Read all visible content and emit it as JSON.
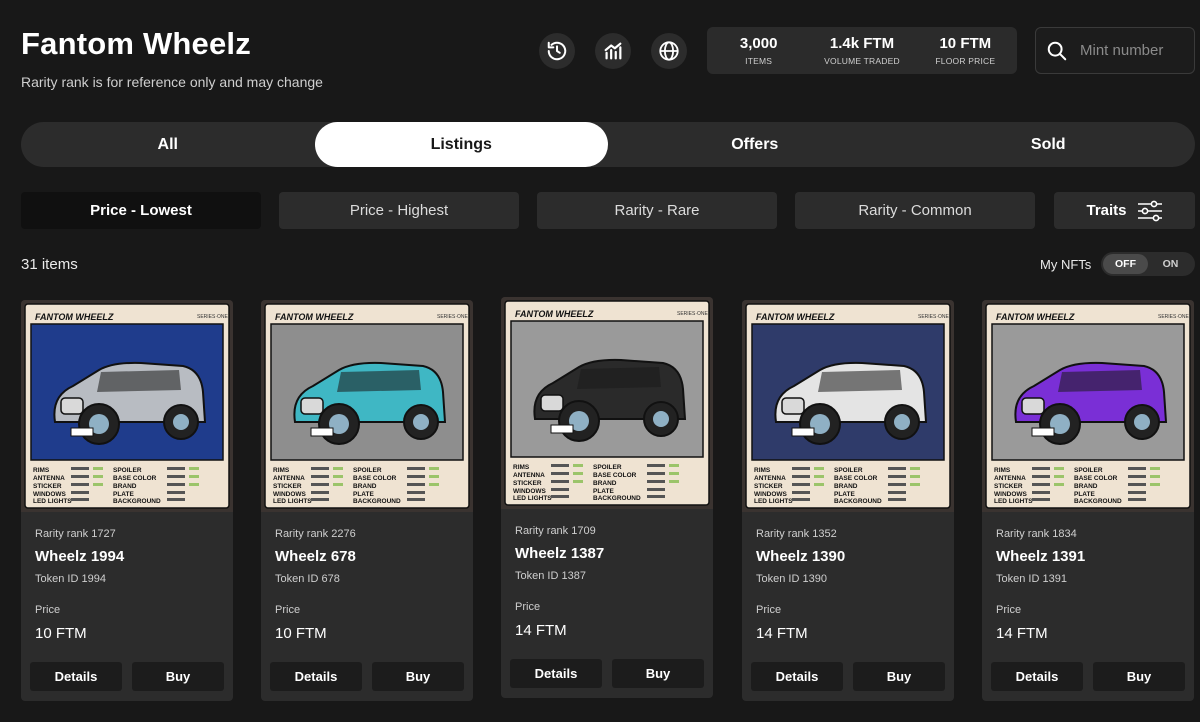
{
  "header": {
    "title": "Fantom Wheelz",
    "subtitle": "Rarity rank is for reference only and may change",
    "icons": [
      "history-icon",
      "activity-chart-icon",
      "globe-icon"
    ]
  },
  "stats": [
    {
      "value": "3,000",
      "label": "ITEMS"
    },
    {
      "value": "1.4k FTM",
      "label": "VOLUME TRADED"
    },
    {
      "value": "10 FTM",
      "label": "FLOOR PRICE"
    }
  ],
  "search": {
    "placeholder": "Mint number",
    "value": ""
  },
  "tabs": [
    {
      "label": "All",
      "active": false
    },
    {
      "label": "Listings",
      "active": true
    },
    {
      "label": "Offers",
      "active": false
    },
    {
      "label": "Sold",
      "active": false
    }
  ],
  "sorts": [
    {
      "label": "Price - Lowest",
      "active": true
    },
    {
      "label": "Price - Highest",
      "active": false
    },
    {
      "label": "Rarity - Rare",
      "active": false
    },
    {
      "label": "Rarity - Common",
      "active": false
    }
  ],
  "traits_label": "Traits",
  "results": {
    "count_text": "31 items"
  },
  "my_nfts": {
    "label": "My NFTs",
    "off": "OFF",
    "on": "ON",
    "state": "OFF"
  },
  "card_text": {
    "price_label": "Price",
    "details_label": "Details",
    "buy_label": "Buy"
  },
  "colors": {
    "accent": "#ffffff",
    "background": "#181818",
    "panel": "#2c2c2c"
  },
  "cards": [
    {
      "rarity": "Rarity rank 1727",
      "name": "Wheelz 1994",
      "token": "Token ID 1994",
      "price": "10 FTM",
      "car_color": "#b8bcc2",
      "bg_color": "#1f3c8c"
    },
    {
      "rarity": "Rarity rank 2276",
      "name": "Wheelz 678",
      "token": "Token ID 678",
      "price": "10 FTM",
      "car_color": "#3fb7c4",
      "bg_color": "#8e8e8e"
    },
    {
      "rarity": "Rarity rank 1709",
      "name": "Wheelz 1387",
      "token": "Token ID 1387",
      "price": "14 FTM",
      "car_color": "#2a2a2a",
      "bg_color": "#9a9a9a"
    },
    {
      "rarity": "Rarity rank 1352",
      "name": "Wheelz 1390",
      "token": "Token ID 1390",
      "price": "14 FTM",
      "car_color": "#e4e4e4",
      "bg_color": "#2f3b6a"
    },
    {
      "rarity": "Rarity rank 1834",
      "name": "Wheelz 1391",
      "token": "Token ID 1391",
      "price": "14 FTM",
      "car_color": "#7a2fd6",
      "bg_color": "#9a9a9a"
    }
  ]
}
